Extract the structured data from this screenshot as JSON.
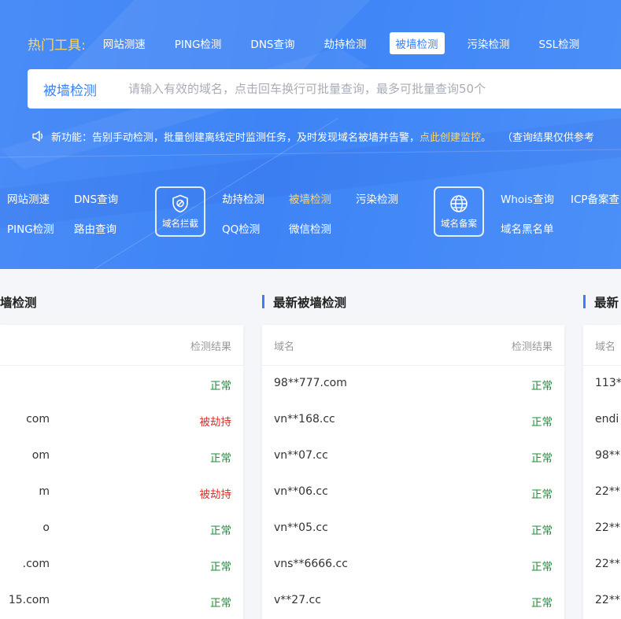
{
  "hot": {
    "label": "热门工具:",
    "items": [
      "网站测速",
      "PING检测",
      "DNS查询",
      "劫持检测",
      "被墙检测",
      "污染检测",
      "SSL检测"
    ],
    "active_index": 4
  },
  "search": {
    "type_label": "被墙检测",
    "placeholder": "请输入有效的域名，点击回车换行可批量查询，最多可批量查询50个"
  },
  "notice": {
    "prefix": "新功能：告别手动检测，批量创建离线定时监测任务，及时发现域名被墙并告警，",
    "link": "点此创建监控",
    "suffix": "。",
    "tail": "（查询结果仅供参考"
  },
  "categories": {
    "group1": [
      "网站测速",
      "DNS查询",
      "PING检测",
      "路由查询"
    ],
    "box1": "域名拦截",
    "group2": [
      "劫持检测",
      "被墙检测",
      "污染检测",
      "QQ检测",
      "微信检测"
    ],
    "box2": "域名备案",
    "group3": [
      "Whois查询",
      "ICP备案查",
      "域名黑名单"
    ]
  },
  "sections": {
    "left_title": "墙检测",
    "middle_title": "最新被墙检测",
    "right_title": "最新",
    "col_domain": "域名",
    "col_result": "检测结果"
  },
  "left_rows": [
    {
      "domain": "",
      "result": "正常",
      "status": "ok"
    },
    {
      "domain": "com",
      "result": "被劫持",
      "status": "bad"
    },
    {
      "domain": "om",
      "result": "正常",
      "status": "ok"
    },
    {
      "domain": "m",
      "result": "被劫持",
      "status": "bad"
    },
    {
      "domain": "o",
      "result": "正常",
      "status": "ok"
    },
    {
      "domain": ".com",
      "result": "正常",
      "status": "ok"
    },
    {
      "domain": "15.com",
      "result": "正常",
      "status": "ok"
    }
  ],
  "middle_rows": [
    {
      "domain": "98**777.com",
      "result": "正常",
      "status": "ok"
    },
    {
      "domain": "vn**168.cc",
      "result": "正常",
      "status": "ok"
    },
    {
      "domain": "vn**07.cc",
      "result": "正常",
      "status": "ok"
    },
    {
      "domain": "vn**06.cc",
      "result": "正常",
      "status": "ok"
    },
    {
      "domain": "vn**05.cc",
      "result": "正常",
      "status": "ok"
    },
    {
      "domain": "vns**6666.cc",
      "result": "正常",
      "status": "ok"
    },
    {
      "domain": "v**27.cc",
      "result": "正常",
      "status": "ok"
    }
  ],
  "right_rows": [
    "113*",
    "endi",
    "98**",
    "22**",
    "22**",
    "22**",
    "22**"
  ],
  "colors": {
    "brand": "#3e84f6",
    "accent_yellow": "#ffd666",
    "ok_green": "#1f8a3a",
    "bad_red": "#e02b2b"
  }
}
